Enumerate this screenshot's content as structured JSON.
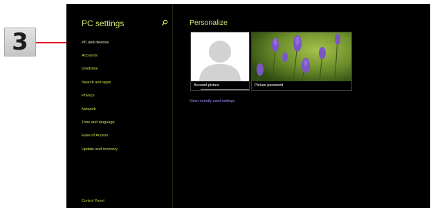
{
  "callout": {
    "step_number": "3"
  },
  "left_pane": {
    "title": "PC settings",
    "items": [
      {
        "label": "PC and devices",
        "selected": true
      },
      {
        "label": "Accounts"
      },
      {
        "label": "OneDrive"
      },
      {
        "label": "Search and apps"
      },
      {
        "label": "Privacy"
      },
      {
        "label": "Network"
      },
      {
        "label": "Time and language"
      },
      {
        "label": "Ease of Access"
      },
      {
        "label": "Update and recovery"
      }
    ],
    "control_panel": "Control Panel"
  },
  "right_pane": {
    "title": "Personalize",
    "tiles": [
      {
        "caption": "Account picture"
      },
      {
        "caption": "Picture password"
      }
    ],
    "link": "View recently used settings"
  },
  "colors": {
    "accent": "#d6e850",
    "link": "#a784ff",
    "callout": "#e0141e"
  },
  "icons": {
    "search": "search-icon",
    "user_silhouette": "user-silhouette-icon"
  }
}
